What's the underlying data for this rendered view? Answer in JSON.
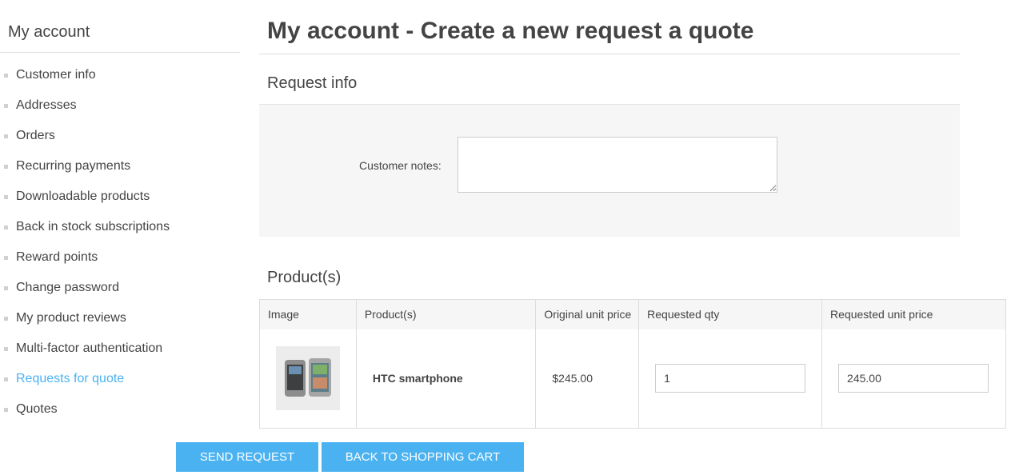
{
  "sidebar": {
    "title": "My account",
    "items": [
      {
        "label": "Customer info"
      },
      {
        "label": "Addresses"
      },
      {
        "label": "Orders"
      },
      {
        "label": "Recurring payments"
      },
      {
        "label": "Downloadable products"
      },
      {
        "label": "Back in stock subscriptions"
      },
      {
        "label": "Reward points"
      },
      {
        "label": "Change password"
      },
      {
        "label": "My product reviews"
      },
      {
        "label": "Multi-factor authentication"
      },
      {
        "label": "Requests for quote",
        "active": true
      },
      {
        "label": "Quotes"
      }
    ]
  },
  "main": {
    "title": "My account - Create a new request a quote",
    "request_info": {
      "heading": "Request info",
      "notes_label": "Customer notes:",
      "notes_value": ""
    },
    "products": {
      "heading": "Product(s)",
      "columns": [
        "Image",
        "Product(s)",
        "Original unit price",
        "Requested qty",
        "Requested unit price"
      ],
      "rows": [
        {
          "image_icon": "smartphone-image",
          "product": "HTC smartphone",
          "original_price": "$245.00",
          "requested_qty": "1",
          "requested_price": "245.00"
        }
      ]
    },
    "buttons": {
      "send": "SEND REQUEST",
      "back": "BACK TO SHOPPING CART"
    }
  },
  "colors": {
    "accent": "#4ab2f1",
    "text": "#444444",
    "panel_bg": "#f6f6f6"
  }
}
